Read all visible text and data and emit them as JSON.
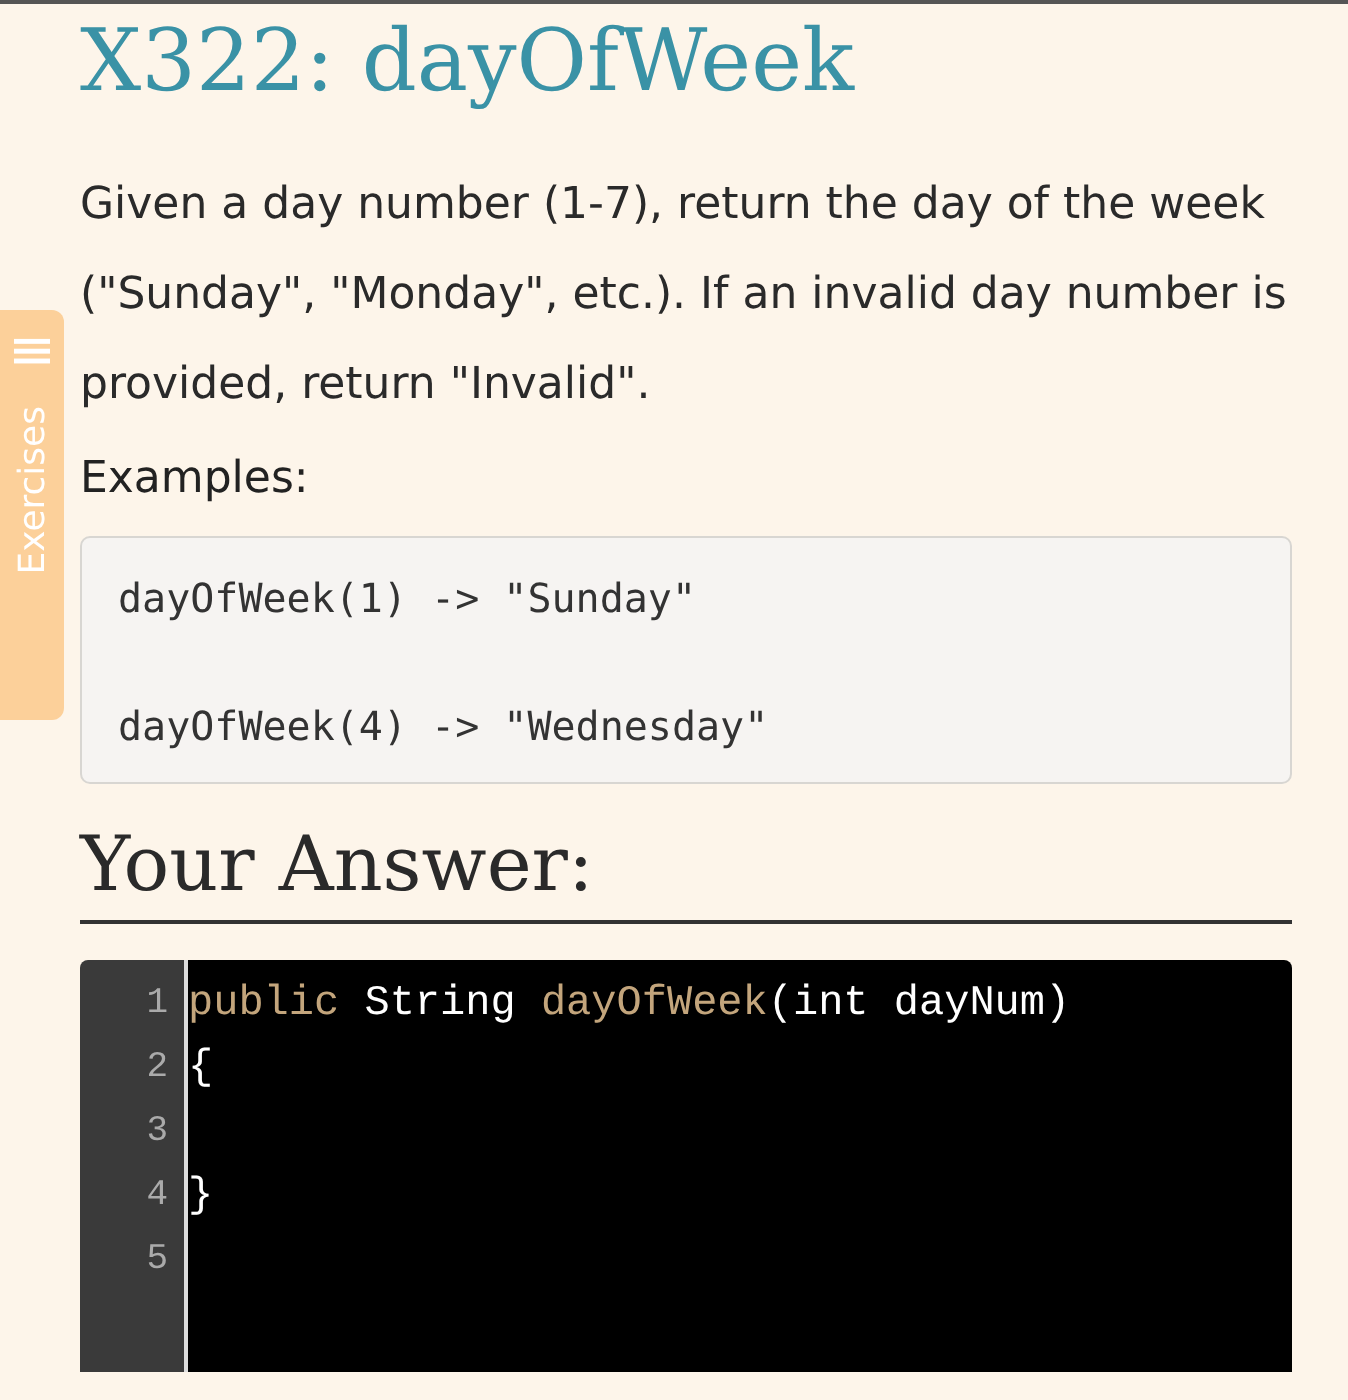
{
  "title": "X322: dayOfWeek",
  "description": "Given a day number (1-7), return the day of the week (\"Sunday\", \"Monday\", etc.). If an invalid day number is provided, return \"Invalid\".",
  "examples_label": "Examples:",
  "examples": [
    "dayOfWeek(1) -> \"Sunday\"",
    "dayOfWeek(4) -> \"Wednesday\""
  ],
  "side_tab": {
    "label": "Exercises"
  },
  "answer_heading": "Your Answer:",
  "editor": {
    "lines": [
      {
        "number": "1",
        "tokens": [
          {
            "kind": "keyword",
            "text": "public"
          },
          {
            "kind": "plain",
            "text": " String "
          },
          {
            "kind": "keyword",
            "text": "dayOfWeek"
          },
          {
            "kind": "plain",
            "text": "(int dayNum)"
          }
        ]
      },
      {
        "number": "2",
        "tokens": [
          {
            "kind": "plain",
            "text": "{"
          }
        ]
      },
      {
        "number": "3"
      },
      {
        "number": "4",
        "tokens": [
          {
            "kind": "plain",
            "text": "}"
          }
        ]
      },
      {
        "number": "5"
      }
    ]
  }
}
